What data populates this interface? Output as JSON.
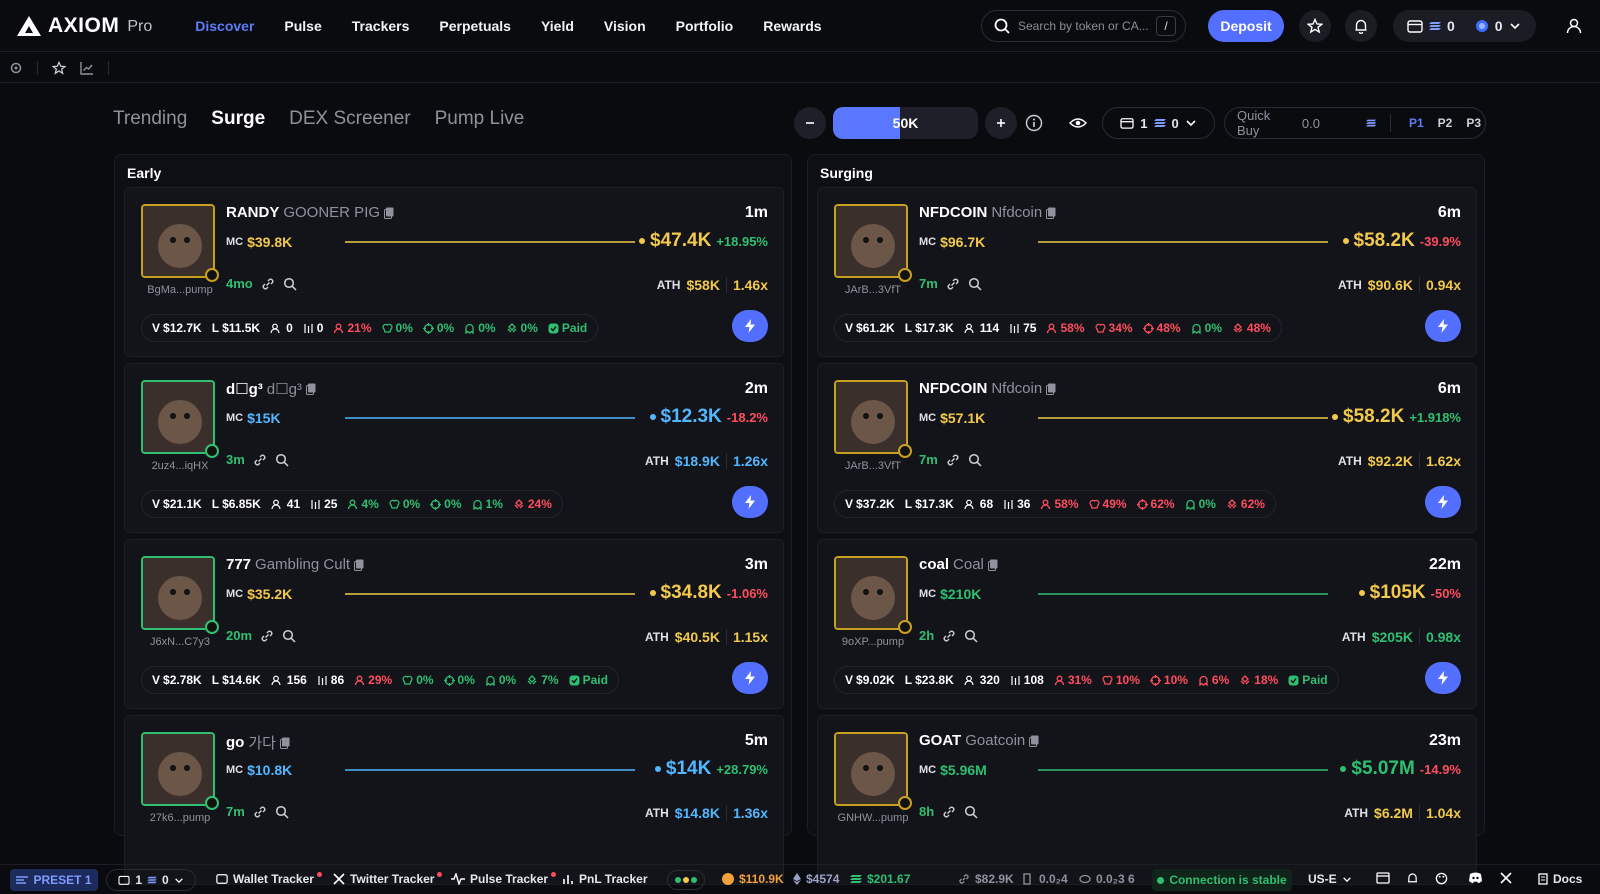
{
  "app": {
    "logo": "AXIOM",
    "logo_suffix": "Pro"
  },
  "nav": [
    "Discover",
    "Pulse",
    "Trackers",
    "Perpetuals",
    "Yield",
    "Vision",
    "Portfolio",
    "Rewards"
  ],
  "search": {
    "placeholder": "Search by token or CA...",
    "shortcut": "/"
  },
  "deposit_label": "Deposit",
  "wallet": {
    "count1": "0",
    "count2": "0"
  },
  "tabs": [
    "Trending",
    "Surge",
    "DEX Screener",
    "Pump Live"
  ],
  "slider": {
    "label": "50K",
    "fill_fraction": 0.46
  },
  "wallet_select": {
    "count": "1",
    "value": "0"
  },
  "quick_buy": {
    "label": "Quick Buy",
    "value": "0.0",
    "presets": [
      "P1",
      "P2",
      "P3"
    ],
    "selected": "P1"
  },
  "columns": {
    "early": "Early",
    "surging": "Surging"
  },
  "colors": {
    "accent": "#526fff",
    "green": "#2fbf71",
    "red": "#ff4d5e",
    "yellow": "#f2c94c",
    "blue": "#52b7ff"
  },
  "early": [
    {
      "symbol": "RANDY",
      "name": "GOONER PIG",
      "addr": "BgMa...pump",
      "age": "1m",
      "mc": "$39.8K",
      "mc_color": "yellow",
      "price": "$47.4K",
      "price_color": "yellow",
      "change": "+18.95%",
      "change_color": "grn",
      "meta_age": "4mo",
      "ath": "$58K",
      "ath_color": "yellow",
      "mult": "1.46x",
      "mult_color": "yellow",
      "v": "$12.7K",
      "l": "$11.5K",
      "holders": "0",
      "pro": "0",
      "p1": "21%",
      "p2": "0%",
      "p3": "0%",
      "p4": "0%",
      "p5": "0%",
      "paid": "Paid",
      "p1c": "red",
      "p2c": "grn",
      "p3c": "grn",
      "p4c": "grn",
      "p5c": "grn",
      "border": "yellow",
      "spark": "yellow"
    },
    {
      "symbol": "d☐g³",
      "name": "d☐g³",
      "addr": "2uz4...iqHX",
      "age": "2m",
      "mc": "$15K",
      "mc_color": "blue",
      "price": "$12.3K",
      "price_color": "blue",
      "change": "-18.2%",
      "change_color": "red",
      "meta_age": "3m",
      "ath": "$18.9K",
      "ath_color": "blue",
      "mult": "1.26x",
      "mult_color": "blue",
      "v": "$21.1K",
      "l": "$6.85K",
      "holders": "41",
      "pro": "25",
      "p1": "4%",
      "p2": "0%",
      "p3": "0%",
      "p4": "1%",
      "p5": "24%",
      "paid": "",
      "p1c": "grn",
      "p2c": "grn",
      "p3c": "grn",
      "p4c": "grn",
      "p5c": "red",
      "border": "green",
      "spark": "blue"
    },
    {
      "symbol": "777",
      "name": "Gambling Cult",
      "addr": "J6xN...C7y3",
      "age": "3m",
      "mc": "$35.2K",
      "mc_color": "yellow",
      "price": "$34.8K",
      "price_color": "yellow",
      "change": "-1.06%",
      "change_color": "red",
      "meta_age": "20m",
      "ath": "$40.5K",
      "ath_color": "yellow",
      "mult": "1.15x",
      "mult_color": "yellow",
      "v": "$2.78K",
      "l": "$14.6K",
      "holders": "156",
      "pro": "86",
      "p1": "29%",
      "p2": "0%",
      "p3": "0%",
      "p4": "0%",
      "p5": "7%",
      "paid": "Paid",
      "p1c": "red",
      "p2c": "grn",
      "p3c": "grn",
      "p4c": "grn",
      "p5c": "grn",
      "border": "green",
      "spark": "yellow"
    },
    {
      "symbol": "go",
      "name": "가다",
      "addr": "27k6...pump",
      "age": "5m",
      "mc": "$10.8K",
      "mc_color": "blue",
      "price": "$14K",
      "price_color": "blue",
      "change": "+28.79%",
      "change_color": "grn",
      "meta_age": "7m",
      "ath": "$14.8K",
      "ath_color": "blue",
      "mult": "1.36x",
      "mult_color": "blue",
      "border": "green",
      "spark": "blue"
    }
  ],
  "surging": [
    {
      "symbol": "NFDCOIN",
      "name": "Nfdcoin",
      "addr": "JArB...3VfT",
      "age": "6m",
      "mc": "$96.7K",
      "mc_color": "yellow",
      "price": "$58.2K",
      "price_color": "yellow",
      "change": "-39.9%",
      "change_color": "red",
      "meta_age": "7m",
      "ath": "$90.6K",
      "ath_color": "yellow",
      "mult": "0.94x",
      "mult_color": "yellow",
      "v": "$61.2K",
      "l": "$17.3K",
      "holders": "114",
      "pro": "75",
      "p1": "58%",
      "p2": "34%",
      "p3": "48%",
      "p4": "0%",
      "p5": "48%",
      "paid": "",
      "p1c": "red",
      "p2c": "red",
      "p3c": "red",
      "p4c": "grn",
      "p5c": "red",
      "border": "yellow",
      "spark": "yellow"
    },
    {
      "symbol": "NFDCOIN",
      "name": "Nfdcoin",
      "addr": "JArB...3VfT",
      "age": "6m",
      "mc": "$57.1K",
      "mc_color": "yellow",
      "price": "$58.2K",
      "price_color": "yellow",
      "change": "+1.918%",
      "change_color": "grn",
      "meta_age": "7m",
      "ath": "$92.2K",
      "ath_color": "yellow",
      "mult": "1.62x",
      "mult_color": "yellow",
      "v": "$37.2K",
      "l": "$17.3K",
      "holders": "68",
      "pro": "36",
      "p1": "58%",
      "p2": "49%",
      "p3": "62%",
      "p4": "0%",
      "p5": "62%",
      "paid": "",
      "p1c": "red",
      "p2c": "red",
      "p3c": "red",
      "p4c": "grn",
      "p5c": "red",
      "border": "yellow",
      "spark": "yellow"
    },
    {
      "symbol": "coal",
      "name": "Coal",
      "addr": "9oXP...pump",
      "age": "22m",
      "mc": "$210K",
      "mc_color": "grn",
      "price": "$105K",
      "price_color": "yellow",
      "change": "-50%",
      "change_color": "red",
      "meta_age": "2h",
      "ath": "$205K",
      "ath_color": "grn",
      "mult": "0.98x",
      "mult_color": "grn",
      "v": "$9.02K",
      "l": "$23.8K",
      "holders": "320",
      "pro": "108",
      "p1": "31%",
      "p2": "10%",
      "p3": "10%",
      "p4": "6%",
      "p5": "18%",
      "paid": "Paid",
      "p1c": "red",
      "p2c": "red",
      "p3c": "red",
      "p4c": "red",
      "p5c": "red",
      "border": "yellow",
      "spark": "grn"
    },
    {
      "symbol": "GOAT",
      "name": "Goatcoin",
      "addr": "GNHW...pump",
      "age": "23m",
      "mc": "$5.96M",
      "mc_color": "grn",
      "price": "$5.07M",
      "price_color": "grn",
      "change": "-14.9%",
      "change_color": "red",
      "meta_age": "8h",
      "ath": "$6.2M",
      "ath_color": "yellow",
      "mult": "1.04x",
      "mult_color": "yellow",
      "border": "yellow",
      "spark": "grn"
    }
  ],
  "bottom": {
    "preset": "PRESET 1",
    "wallets": "1",
    "wallet_val": "0",
    "wallet_tracker": "Wallet Tracker",
    "twitter_tracker": "Twitter Tracker",
    "pulse_tracker": "Pulse Tracker",
    "pnl_tracker": "PnL Tracker",
    "btc": "$110.9K",
    "eth": "$4574",
    "sol": "$201.67",
    "fee1": "$82.9K",
    "fee2": "0.0₂4",
    "fee3": "0.0₂3 6",
    "connection": "Connection is stable",
    "region": "US-E",
    "docs": "Docs"
  }
}
